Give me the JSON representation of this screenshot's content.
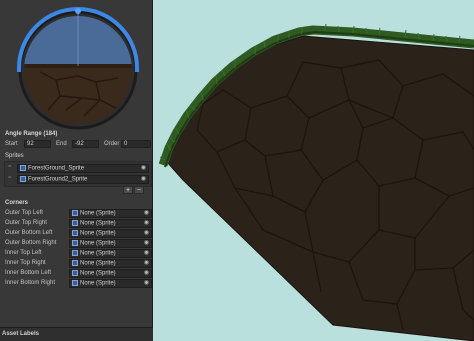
{
  "inspector": {
    "angle_range": {
      "title": "Angle Range (184)",
      "start_label": "Start",
      "start_value": "92",
      "end_label": "End",
      "end_value": "-92",
      "order_label": "Order",
      "order_value": "0"
    },
    "sprites": {
      "title": "Sprites",
      "items": [
        "ForestGround_Sprite",
        "ForestGround2_Sprite"
      ],
      "add_symbol": "+",
      "remove_symbol": "−"
    },
    "corners": {
      "title": "Corners",
      "items": [
        {
          "label": "Outer Top Left",
          "value": "None (Sprite)"
        },
        {
          "label": "Outer Top Right",
          "value": "None (Sprite)"
        },
        {
          "label": "Outer Bottom Left",
          "value": "None (Sprite)"
        },
        {
          "label": "Outer Bottom Right",
          "value": "None (Sprite)"
        },
        {
          "label": "Inner Top Left",
          "value": "None (Sprite)"
        },
        {
          "label": "Inner Top Right",
          "value": "None (Sprite)"
        },
        {
          "label": "Inner Bottom Left",
          "value": "None (Sprite)"
        },
        {
          "label": "Inner Bottom Right",
          "value": "None (Sprite)"
        }
      ]
    },
    "asset_labels": "Asset Labels",
    "icons": {
      "object_field": "sprite-object-icon",
      "picker": "target-picker-icon"
    }
  },
  "colors": {
    "panel_bg": "#383838",
    "field_bg": "#2a2a2a",
    "dial_arc": "#3d87e6",
    "scene_bg": "#b9e0dc",
    "soil": "#2b221a",
    "grass": "#2f5a22"
  }
}
